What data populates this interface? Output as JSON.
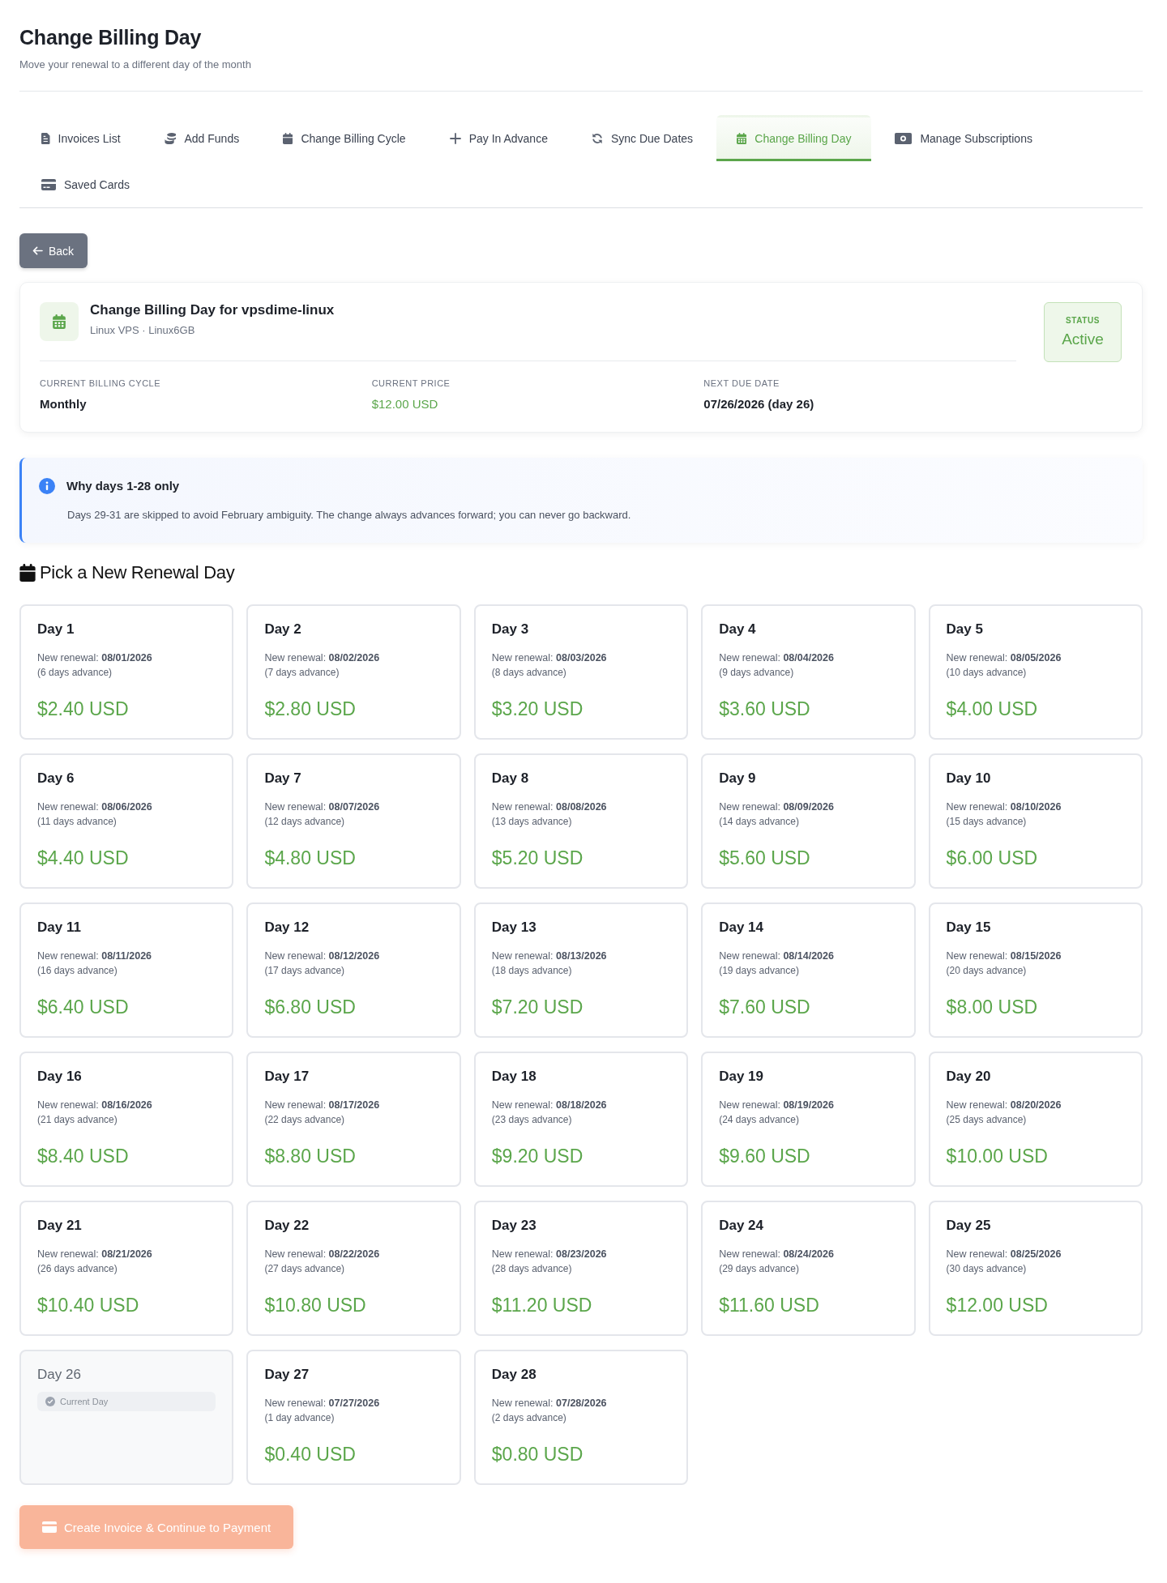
{
  "page": {
    "title": "Change Billing Day",
    "subtitle": "Move your renewal to a different day of the month"
  },
  "tabs": [
    {
      "label": "Invoices List",
      "selected": false
    },
    {
      "label": "Add Funds",
      "selected": false
    },
    {
      "label": "Change Billing Cycle",
      "selected": false
    },
    {
      "label": "Pay In Advance",
      "selected": false
    },
    {
      "label": "Sync Due Dates",
      "selected": false
    },
    {
      "label": "Change Billing Day",
      "selected": true
    },
    {
      "label": "Manage Subscriptions",
      "selected": false
    },
    {
      "label": "Saved Cards",
      "selected": false
    }
  ],
  "back_button": {
    "label": "Back"
  },
  "service": {
    "title": "Change Billing Day for vpsdime-linux",
    "subtitle": "Linux VPS · Linux6GB",
    "status": {
      "label": "STATUS",
      "value": "Active"
    },
    "fields": [
      {
        "label": "CURRENT BILLING CYCLE",
        "value": "Monthly",
        "kind": "text"
      },
      {
        "label": "CURRENT PRICE",
        "value": "$12.00 USD",
        "kind": "price"
      },
      {
        "label": "NEXT DUE DATE",
        "value": "07/26/2026 (day 26)",
        "kind": "text"
      }
    ]
  },
  "notice": {
    "title": "Why days 1-28 only",
    "text": "Days 29-31 are skipped to avoid February ambiguity. The change always advances forward; you can never go backward."
  },
  "day_picker": {
    "heading": "Pick a New Renewal Day",
    "days": [
      {
        "label": "Day 1",
        "renewal": "New renewal: **08/01/2026**",
        "advance": "(6 days advance)",
        "price": "$2.40 USD",
        "current": false,
        "selected": false
      },
      {
        "label": "Day 2",
        "renewal": "New renewal: **08/02/2026**",
        "advance": "(7 days advance)",
        "price": "$2.80 USD",
        "current": false,
        "selected": false
      },
      {
        "label": "Day 3",
        "renewal": "New renewal: **08/03/2026**",
        "advance": "(8 days advance)",
        "price": "$3.20 USD",
        "current": false,
        "selected": false
      },
      {
        "label": "Day 4",
        "renewal": "New renewal: **08/04/2026**",
        "advance": "(9 days advance)",
        "price": "$3.60 USD",
        "current": false,
        "selected": false
      },
      {
        "label": "Day 5",
        "renewal": "New renewal: **08/05/2026**",
        "advance": "(10 days advance)",
        "price": "$4.00 USD",
        "current": false,
        "selected": false
      },
      {
        "label": "Day 6",
        "renewal": "New renewal: **08/06/2026**",
        "advance": "(11 days advance)",
        "price": "$4.40 USD",
        "current": false,
        "selected": false
      },
      {
        "label": "Day 7",
        "renewal": "New renewal: **08/07/2026**",
        "advance": "(12 days advance)",
        "price": "$4.80 USD",
        "current": false,
        "selected": false
      },
      {
        "label": "Day 8",
        "renewal": "New renewal: **08/08/2026**",
        "advance": "(13 days advance)",
        "price": "$5.20 USD",
        "current": false,
        "selected": false
      },
      {
        "label": "Day 9",
        "renewal": "New renewal: **08/09/2026**",
        "advance": "(14 days advance)",
        "price": "$5.60 USD",
        "current": false,
        "selected": false
      },
      {
        "label": "Day 10",
        "renewal": "New renewal: **08/10/2026**",
        "advance": "(15 days advance)",
        "price": "$6.00 USD",
        "current": false,
        "selected": false
      },
      {
        "label": "Day 11",
        "renewal": "New renewal: **08/11/2026**",
        "advance": "(16 days advance)",
        "price": "$6.40 USD",
        "current": false,
        "selected": false
      },
      {
        "label": "Day 12",
        "renewal": "New renewal: **08/12/2026**",
        "advance": "(17 days advance)",
        "price": "$6.80 USD",
        "current": false,
        "selected": false
      },
      {
        "label": "Day 13",
        "renewal": "New renewal: **08/13/2026**",
        "advance": "(18 days advance)",
        "price": "$7.20 USD",
        "current": false,
        "selected": false
      },
      {
        "label": "Day 14",
        "renewal": "New renewal: **08/14/2026**",
        "advance": "(19 days advance)",
        "price": "$7.60 USD",
        "current": false,
        "selected": false
      },
      {
        "label": "Day 15",
        "renewal": "New renewal: **08/15/2026**",
        "advance": "(20 days advance)",
        "price": "$8.00 USD",
        "current": false,
        "selected": false
      },
      {
        "label": "Day 16",
        "renewal": "New renewal: **08/16/2026**",
        "advance": "(21 days advance)",
        "price": "$8.40 USD",
        "current": false,
        "selected": false
      },
      {
        "label": "Day 17",
        "renewal": "New renewal: **08/17/2026**",
        "advance": "(22 days advance)",
        "price": "$8.80 USD",
        "current": false,
        "selected": false
      },
      {
        "label": "Day 18",
        "renewal": "New renewal: **08/18/2026**",
        "advance": "(23 days advance)",
        "price": "$9.20 USD",
        "current": false,
        "selected": false
      },
      {
        "label": "Day 19",
        "renewal": "New renewal: **08/19/2026**",
        "advance": "(24 days advance)",
        "price": "$9.60 USD",
        "current": false,
        "selected": false
      },
      {
        "label": "Day 20",
        "renewal": "New renewal: **08/20/2026**",
        "advance": "(25 days advance)",
        "price": "$10.00 USD",
        "current": false,
        "selected": false
      },
      {
        "label": "Day 21",
        "renewal": "New renewal: **08/21/2026**",
        "advance": "(26 days advance)",
        "price": "$10.40 USD",
        "current": false,
        "selected": false
      },
      {
        "label": "Day 22",
        "renewal": "New renewal: **08/22/2026**",
        "advance": "(27 days advance)",
        "price": "$10.80 USD",
        "current": false,
        "selected": false
      },
      {
        "label": "Day 23",
        "renewal": "New renewal: **08/23/2026**",
        "advance": "(28 days advance)",
        "price": "$11.20 USD",
        "current": false,
        "selected": false
      },
      {
        "label": "Day 24",
        "renewal": "New renewal: **08/24/2026**",
        "advance": "(29 days advance)",
        "price": "$11.60 USD",
        "current": false,
        "selected": false
      },
      {
        "label": "Day 25",
        "renewal": "New renewal: **08/25/2026**",
        "advance": "(30 days advance)",
        "price": "$12.00 USD",
        "current": false,
        "selected": false
      },
      {
        "label": "Day 26",
        "badge": "Current Day",
        "current": true,
        "selected": false
      },
      {
        "label": "Day 27",
        "renewal": "New renewal: **07/27/2026**",
        "advance": "(1 day advance)",
        "price": "$0.40 USD",
        "current": false,
        "selected": false
      },
      {
        "label": "Day 28",
        "renewal": "New renewal: **07/28/2026**",
        "advance": "(2 days advance)",
        "price": "$0.80 USD",
        "current": false,
        "selected": false
      }
    ]
  },
  "submit_button": {
    "label": "Create Invoice & Continue to Payment",
    "disabled": true
  }
}
